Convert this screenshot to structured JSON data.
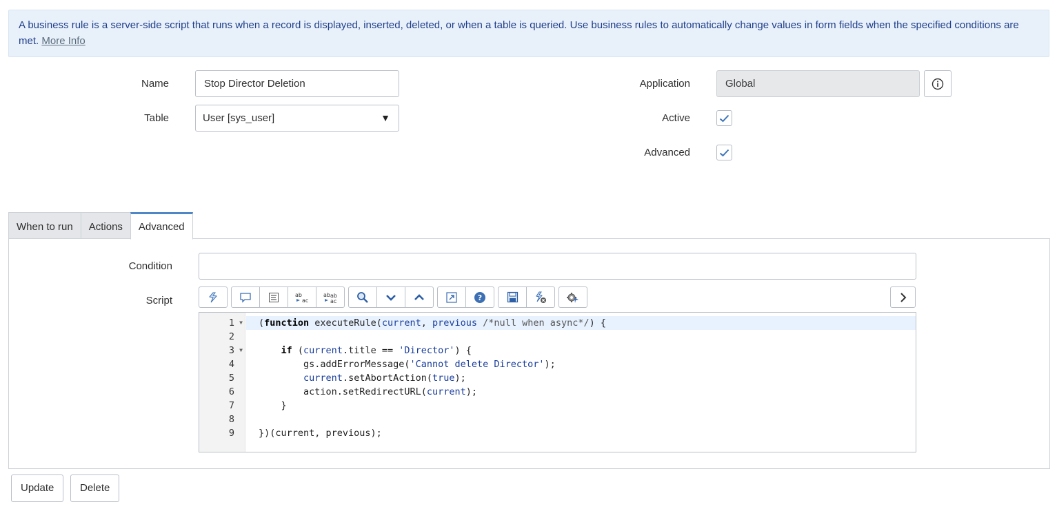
{
  "info_banner": {
    "text": "A business rule is a server-side script that runs when a record is displayed, inserted, deleted, or when a table is queried. Use business rules to automatically change values in form fields when the specified conditions are met.",
    "more_info_label": "More Info"
  },
  "form": {
    "name_label": "Name",
    "name_value": "Stop Director Deletion",
    "table_label": "Table",
    "table_value": "User [sys_user]",
    "application_label": "Application",
    "application_value": "Global",
    "active_label": "Active",
    "active_checked": true,
    "advanced_label": "Advanced",
    "advanced_checked": true
  },
  "tabs": [
    {
      "label": "When to run",
      "active": false
    },
    {
      "label": "Actions",
      "active": false
    },
    {
      "label": "Advanced",
      "active": true
    }
  ],
  "advanced_tab": {
    "condition_label": "Condition",
    "condition_value": "",
    "script_label": "Script"
  },
  "toolbar": {
    "icons": [
      "format-code-icon",
      "comment-icon",
      "format-icon",
      "replace-icon",
      "replace-all-icon",
      "search-icon",
      "next-icon",
      "previous-icon",
      "script-include-icon",
      "help-icon",
      "save-icon",
      "debug-icon",
      "script-debugger-icon"
    ]
  },
  "code": {
    "lines": [
      {
        "n": "1",
        "fold": true
      },
      {
        "n": "2",
        "fold": false
      },
      {
        "n": "3",
        "fold": true
      },
      {
        "n": "4",
        "fold": false
      },
      {
        "n": "5",
        "fold": false
      },
      {
        "n": "6",
        "fold": false
      },
      {
        "n": "7",
        "fold": false
      },
      {
        "n": "8",
        "fold": false
      },
      {
        "n": "9",
        "fold": false
      }
    ],
    "tokens": {
      "l1_open": "(",
      "l1_function": "function",
      "l1_name": " executeRule(",
      "l1_current": "current",
      "l1_comma": ", ",
      "l1_previous": "previous",
      "l1_comment": " /*null when async*/",
      "l1_close": ") {",
      "l3_if": "if",
      "l3_open": " (",
      "l3_current": "current",
      "l3_rest": ".title == ",
      "l3_str": "'Director'",
      "l3_close": ") {",
      "l4_call": "gs.addErrorMessage(",
      "l4_str": "'Cannot delete Director'",
      "l4_close": ");",
      "l5_current": "current",
      "l5_call": ".setAbortAction(",
      "l5_true": "true",
      "l5_close": ");",
      "l6_call": "action.setRedirectURL(",
      "l6_current": "current",
      "l6_close": ");",
      "l7_brace": "}",
      "l9_text": "})(current, previous);"
    }
  },
  "actions": {
    "update_label": "Update",
    "delete_label": "Delete"
  },
  "colors": {
    "banner_bg": "#e8f1fa",
    "banner_text": "#1f3d8a",
    "accent": "#4f86c6",
    "check": "#3b73b9"
  }
}
